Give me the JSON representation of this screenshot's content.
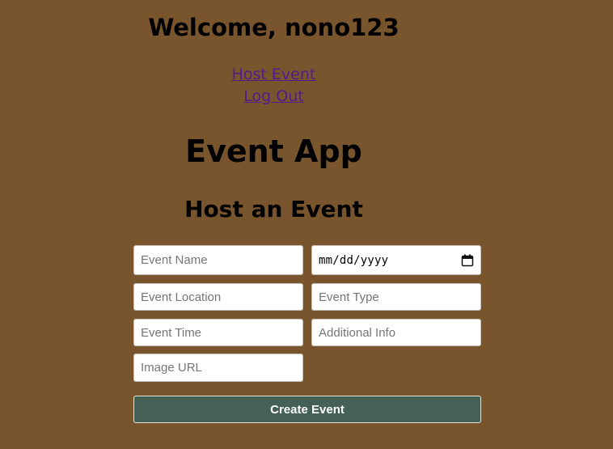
{
  "header": {
    "welcome": "Welcome, nono123"
  },
  "nav": {
    "host_event": "Host Event",
    "log_out": "Log Out"
  },
  "app": {
    "title": "Event App"
  },
  "form": {
    "title": "Host an Event",
    "event_name": {
      "placeholder": "Event Name",
      "value": ""
    },
    "event_date": {
      "placeholder": "mm/dd/yyyy",
      "value": ""
    },
    "event_location": {
      "placeholder": "Event Location",
      "value": ""
    },
    "event_type": {
      "placeholder": "Event Type",
      "value": ""
    },
    "event_time": {
      "placeholder": "Event Time",
      "value": ""
    },
    "additional_info": {
      "placeholder": "Additional Info",
      "value": ""
    },
    "image_url": {
      "placeholder": "Image URL",
      "value": ""
    },
    "submit_label": "Create Event"
  },
  "colors": {
    "background": "#79552e",
    "link": "#551a8b",
    "button": "#456155",
    "button_text": "#ffffff"
  },
  "icons": {
    "date_picker": "calendar-icon"
  }
}
